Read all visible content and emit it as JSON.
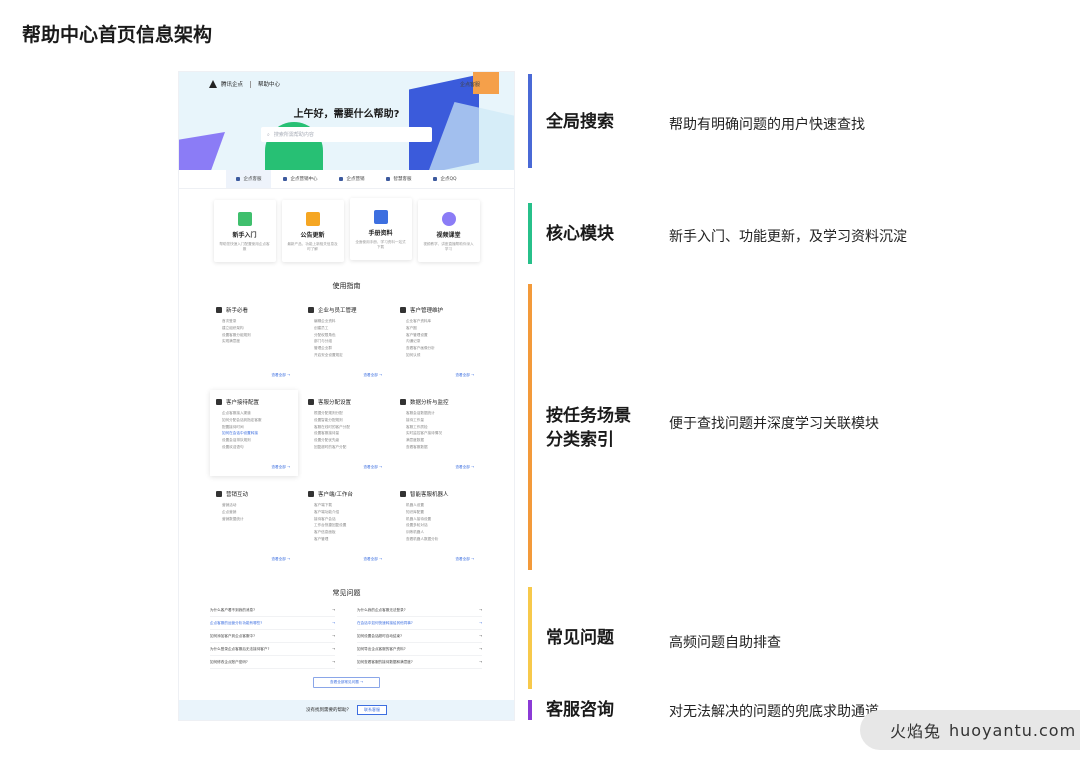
{
  "page_title": "帮助中心首页信息架构",
  "mockup": {
    "logo": "腾讯企点",
    "logo_sub": "帮助中心",
    "hero_right": "企点客服",
    "greeting": "上午好，需要什么帮助?",
    "search_placeholder": "搜索所需帮助内容",
    "tabs": [
      "企点客服",
      "企点营销中心",
      "企点营销",
      "智慧客服",
      "企点QQ"
    ],
    "cards": [
      {
        "title": "新手入门",
        "desc": "帮助您快速入门配置使用企点客服",
        "color": "#3fbf6d"
      },
      {
        "title": "公告更新",
        "desc": "最新产品、功能上新相关信息及时了解",
        "color": "#f5a623"
      },
      {
        "title": "手册资料",
        "desc": "全面使用手册、学习资料一站式下载",
        "color": "#3d6fe0"
      },
      {
        "title": "视频课堂",
        "desc": "视频教学、讲座直播帮助你深入学习",
        "color": "#8b7cf6"
      }
    ],
    "guide_title": "使用指南",
    "guides": [
      {
        "title": "新手必看",
        "items": [
          "首次登录",
          "建立组织架构",
          "设置客服分组规则",
          "实现满意度"
        ]
      },
      {
        "title": "企业与员工管理",
        "items": [
          "编辑企业资料",
          "创建员工",
          "分配权限角色",
          "部门与分组",
          "管理企业群",
          "开启安全设置规定"
        ]
      },
      {
        "title": "客户管理维护",
        "items": [
          "企业客户资料库",
          "客户圈",
          "客户管理设置",
          "沟通记录",
          "查看客户画像分析",
          "如何认领"
        ]
      },
      {
        "title": "客户接待配置",
        "items": [
          "企点客服接入渠道",
          "如何分配会话到指定客服",
          "配置接待时间",
          "如何在会话中设置转接",
          "设置会话排队规则",
          "设置欢迎语句"
        ]
      },
      {
        "title": "客服分配设置",
        "items": [
          "根据分配规则分配",
          "设置智能分配规则",
          "客服在线时的客户分配",
          "设置客服接待量",
          "设置分配优先级",
          "回复超时的客户分配"
        ]
      },
      {
        "title": "数据分析与监控",
        "items": [
          "客服会话数据统计",
          "接待工作量",
          "客服工作质检",
          "实时监控客户接待情况",
          "满意度数据",
          "查看客服数据"
        ]
      },
      {
        "title": "营销互动",
        "items": [
          "营销活动",
          "企点营销",
          "营销数据统计"
        ]
      },
      {
        "title": "客户端/工作台",
        "items": [
          "客户端下载",
          "客户端功能介绍",
          "接待客户会话",
          "工作台快捷回复设置",
          "客户信息面板",
          "客户管理"
        ]
      },
      {
        "title": "智能客服机器人",
        "items": [
          "机器人设置",
          "知识库配置",
          "机器人接待设置",
          "设置多轮对话",
          "训练机器人",
          "查看机器人数据分析"
        ]
      }
    ],
    "guide_more": "查看全部 →",
    "faq_title": "常见问题",
    "faq_left": [
      "为什么客户看不到我的消息?",
      "企点客服的运营分析功能有哪些?",
      "如何添加客户到企点客服中?",
      "为什么登录企点客服后无法接待客户?",
      "如何修改企点账户密码?"
    ],
    "faq_right": [
      "为什么我的企点客服无法登录?",
      "在会话中如何快速转接给其他同事?",
      "如何设置会话超时自动结束?",
      "如何导出企点客服的客户资料?",
      "如何查看客服的接待数据和满意度?"
    ],
    "faq_link_index_left": 1,
    "faq_link_index_right": 1,
    "faq_button": "查看全部常见问题 →",
    "footer_text": "没有找到需要的帮助？",
    "footer_button": "联系客服"
  },
  "annotations": [
    {
      "title": "全局搜索",
      "desc": "帮助有明确问题的用户快速查找",
      "color": "#4a69d6"
    },
    {
      "title": "核心模块",
      "desc": "新手入门、功能更新，及学习资料沉淀",
      "color": "#27c08a"
    },
    {
      "title": "按任务场景\n分类索引",
      "title_line1": "按任务场景",
      "title_line2": "分类索引",
      "desc": "便于查找问题并深度学习关联模块",
      "color": "#f39a3a"
    },
    {
      "title": "常见问题",
      "desc": "高频问题自助排查",
      "color": "#f7c94b"
    },
    {
      "title": "客服咨询",
      "desc": "对无法解决的问题的兜底求助通道",
      "color": "#8b3bd6"
    }
  ],
  "watermark": {
    "glyphs": "火焰兔",
    "site": "huoyantu.com"
  }
}
